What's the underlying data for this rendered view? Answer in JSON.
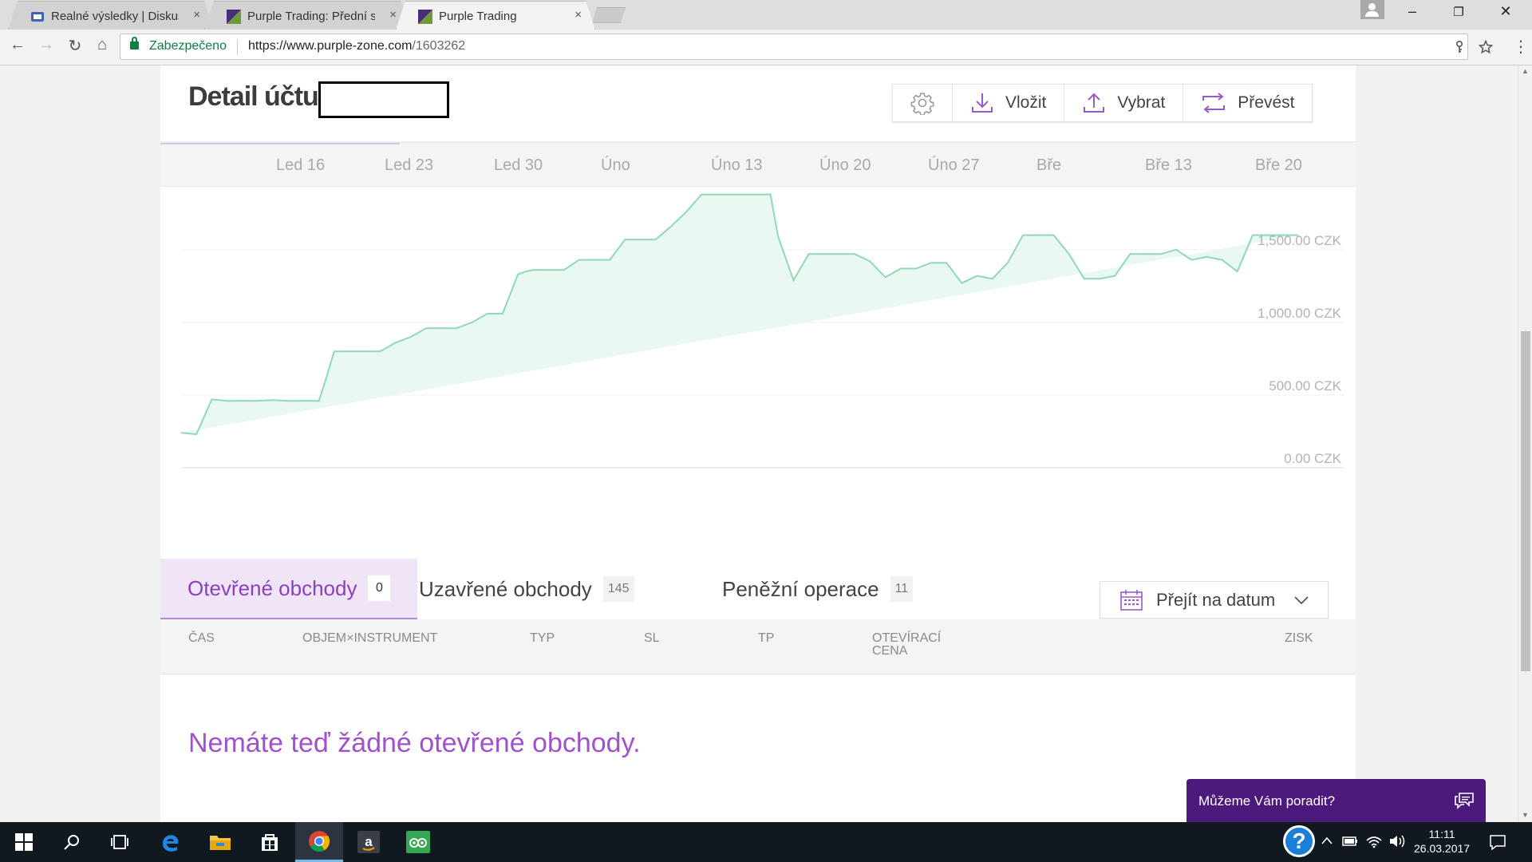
{
  "browser": {
    "tabs": [
      {
        "title": "Realné výsledky | Diskus",
        "close": "×"
      },
      {
        "title": "Purple Trading: Přední sv",
        "close": "×"
      },
      {
        "title": "Purple Trading",
        "close": "×"
      }
    ],
    "window_controls": {
      "minimize": "–",
      "restore": "❐",
      "close": "✕"
    },
    "nav": {
      "back": "←",
      "forward": "→",
      "reload": "↻",
      "home": "⌂"
    },
    "secure_label": "Zabezpečeno",
    "url_host": "https://www.purple-zone.com",
    "url_path": "/1603262",
    "menu": "⋮"
  },
  "page": {
    "title": "Detail účtu",
    "actions": {
      "deposit": "Vložit",
      "withdraw": "Vybrat",
      "transfer": "Převést"
    },
    "tabs": [
      {
        "label": "Otevřené obchody",
        "count": "0"
      },
      {
        "label": "Uzavřené obchody",
        "count": "145"
      },
      {
        "label": "Peněžní operace",
        "count": "11"
      }
    ],
    "date_picker": "Přejít na datum",
    "table_headers": [
      "ČAS",
      "OBJEM×INSTRUMENT",
      "TYP",
      "SL",
      "TP",
      "OTEVÍRACÍ CENA",
      "ZISK"
    ],
    "empty_message": "Nemáte teď žádné otevřené obchody.",
    "chat_label": "Můžeme Vám poradit?"
  },
  "chart_data": {
    "type": "area",
    "x_ticks": [
      "Led 16",
      "Led 23",
      "Led 30",
      "Úno",
      "Úno 13",
      "Úno 20",
      "Úno 27",
      "Bře",
      "Bře 13",
      "Bře 20"
    ],
    "y_ticks": [
      "1,500.00 CZK",
      "1,000.00 CZK",
      "500.00 CZK",
      "0.00 CZK"
    ],
    "ylim": [
      0,
      1900
    ],
    "x_range": [
      0,
      76
    ],
    "x": [
      0,
      1,
      2,
      3,
      4,
      5,
      6,
      7,
      8,
      9,
      9.5,
      10,
      11,
      12,
      13,
      14,
      15,
      16,
      17,
      18,
      19,
      20,
      21,
      22,
      22.5,
      23,
      24,
      25,
      26,
      27,
      28,
      29,
      30,
      31,
      32,
      33,
      34,
      35,
      36,
      37,
      38,
      38.5,
      39,
      40,
      41,
      42,
      43,
      44,
      45,
      46,
      47,
      48,
      49,
      50,
      51,
      52,
      53,
      54,
      55,
      56,
      57,
      58,
      59,
      60,
      61,
      62,
      63,
      64,
      65,
      66,
      67,
      68,
      69,
      70,
      71,
      72,
      73,
      74,
      75,
      76
    ],
    "values": [
      240,
      230,
      470,
      460,
      460,
      460,
      465,
      460,
      460,
      460,
      625,
      800,
      800,
      800,
      800,
      860,
      900,
      960,
      960,
      960,
      1000,
      1060,
      1060,
      1330,
      1350,
      1360,
      1360,
      1360,
      1430,
      1430,
      1430,
      1570,
      1570,
      1570,
      1660,
      1760,
      1880,
      1880,
      1880,
      1880,
      1880,
      1880,
      1590,
      1290,
      1470,
      1470,
      1470,
      1470,
      1420,
      1310,
      1370,
      1370,
      1410,
      1410,
      1270,
      1320,
      1300,
      1410,
      1600,
      1600,
      1600,
      1470,
      1300,
      1300,
      1320,
      1470,
      1470,
      1470,
      1500,
      1430,
      1450,
      1430,
      1350,
      1600,
      1600,
      1600,
      1600
    ]
  },
  "taskbar": {
    "help": "?",
    "time": "11:11",
    "date": "26.03.2017"
  },
  "colors": {
    "accent_purple": "#8c3fbf",
    "chart_line": "#8fd9b6",
    "chart_fill": "#eaf8f2",
    "chat_bg": "#4b1a7c"
  }
}
